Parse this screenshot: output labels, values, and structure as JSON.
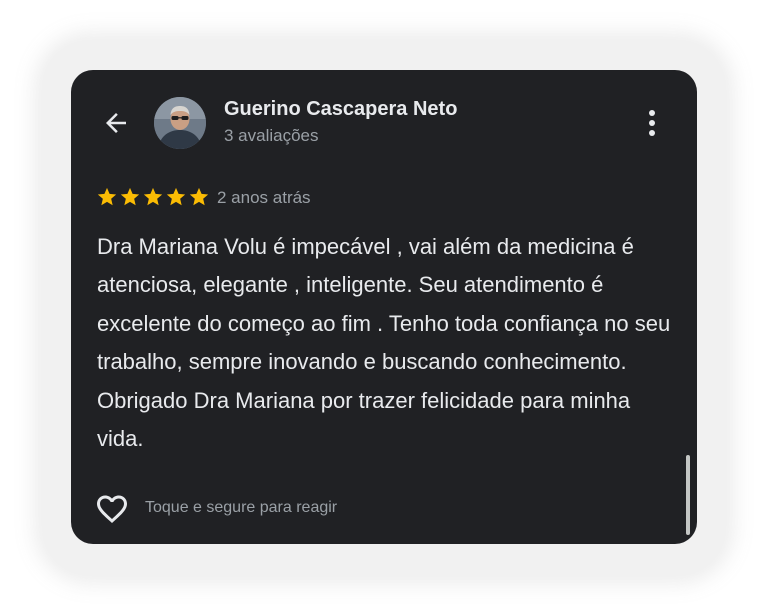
{
  "review": {
    "author_name": "Guerino Cascapera Neto",
    "author_reviews": "3 avaliações",
    "rating": 5,
    "rating_max": 5,
    "time_ago": "2 anos atrás",
    "text": "Dra Mariana Volu é impecável , vai além da medicina é atenciosa, elegante , inteligente. Seu atendimento é excelente do começo ao fim . Tenho toda confiança no seu trabalho, sempre inovando e buscando conhecimento. Obrigado Dra Mariana por trazer felicidade para minha vida.",
    "react_hint": "Toque e segure para reagir"
  },
  "icons": {
    "back": "arrow-left-icon",
    "more": "more-vert-icon",
    "star": "star-icon",
    "react": "heart-outline-icon"
  },
  "colors": {
    "card_background": "#202124",
    "star": "#fbbc04",
    "primary_text": "#e8eaed",
    "secondary_text": "#9aa0a6"
  }
}
